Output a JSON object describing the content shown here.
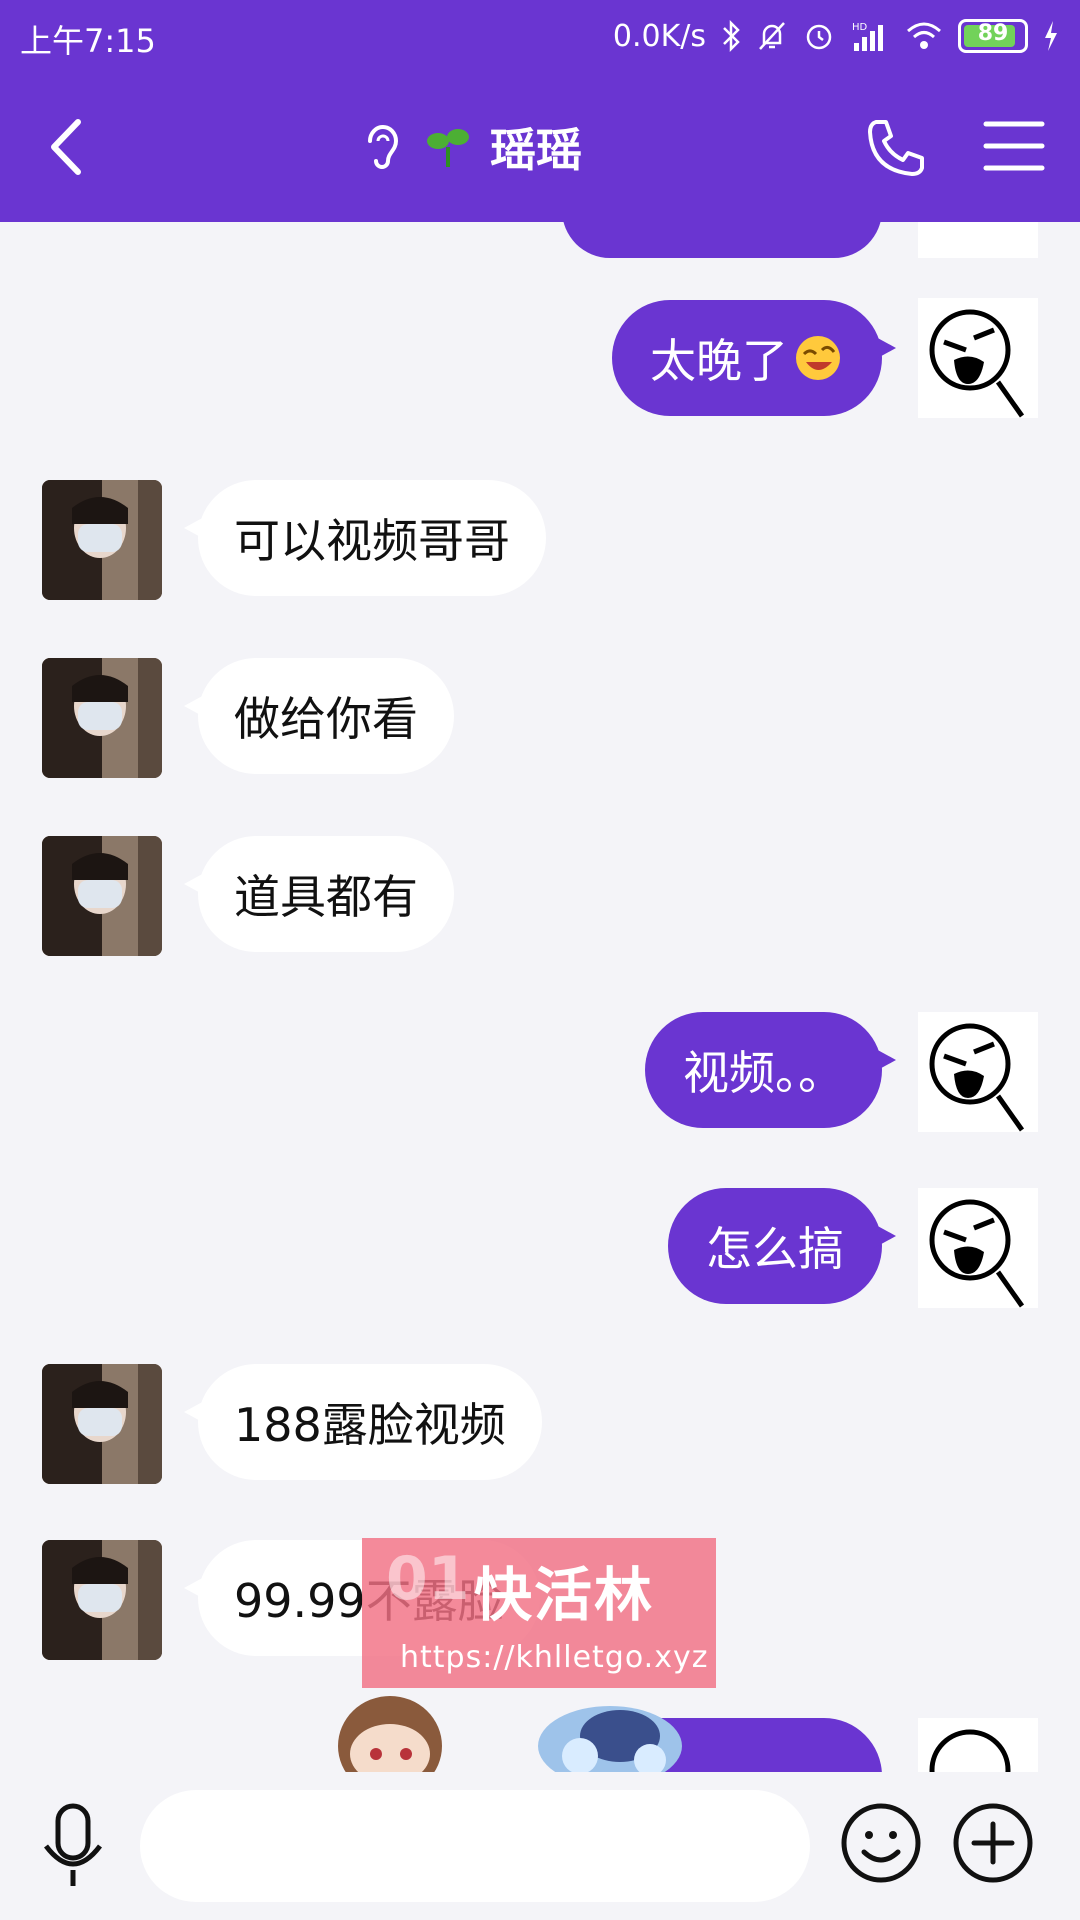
{
  "status_bar": {
    "time": "上午7:15",
    "network_speed": "0.0K/s",
    "battery": "89",
    "battery_level": 0.89,
    "icons": [
      "bluetooth-icon",
      "mute-bell-icon",
      "alarm-icon",
      "hd-signal-icon",
      "wifi-icon",
      "battery-icon",
      "charging-icon"
    ]
  },
  "header": {
    "title": "瑶瑶",
    "icons": [
      "back-icon",
      "ear-icon",
      "sprout-icon",
      "phone-icon",
      "menu-icon"
    ]
  },
  "messages": [
    {
      "side": "right",
      "text": "太晚了"
    },
    {
      "side": "left",
      "text": "可以视频哥哥"
    },
    {
      "side": "left",
      "text": "做给你看"
    },
    {
      "side": "left",
      "text": "道具都有"
    },
    {
      "side": "right",
      "text": "视频。。"
    },
    {
      "side": "right",
      "text": "怎么搞"
    },
    {
      "side": "left",
      "text": "188露脸视频"
    },
    {
      "side": "left",
      "text": "99.99不露脸"
    }
  ],
  "watermark": {
    "number": "01",
    "name": "快活林",
    "url": "https://khlletgo.xyz"
  },
  "colors": {
    "accent": "#6a35d1",
    "background": "#f4f4f8",
    "watermark": "#f27084"
  }
}
